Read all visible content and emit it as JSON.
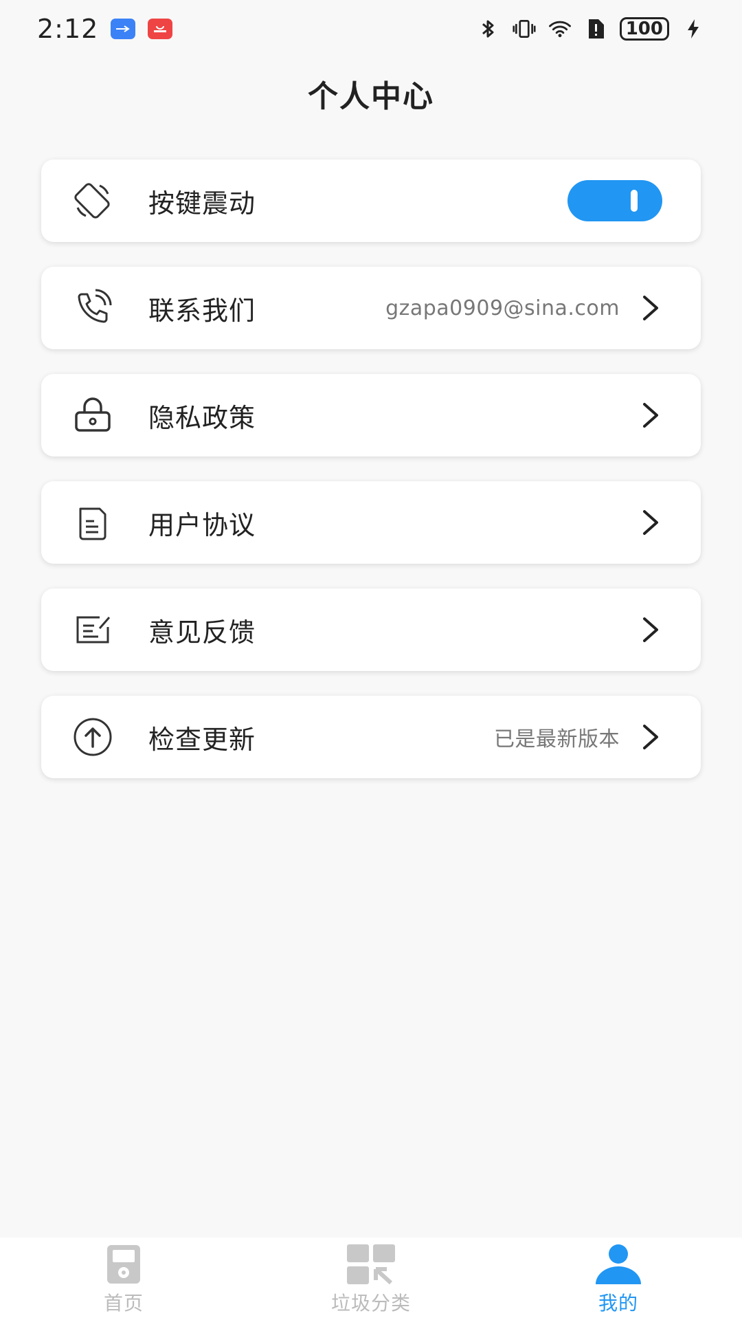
{
  "status_bar": {
    "time": "2:12",
    "battery": "100"
  },
  "header": {
    "title": "个人中心"
  },
  "menu": {
    "vibration": {
      "label": "按键震动",
      "icon": "rotate-phone-icon",
      "toggle_on": true
    },
    "contact": {
      "label": "联系我们",
      "value": "gzapa0909@sina.com",
      "icon": "phone-call-icon"
    },
    "privacy": {
      "label": "隐私政策",
      "icon": "lock-icon"
    },
    "agreement": {
      "label": "用户协议",
      "icon": "document-icon"
    },
    "feedback": {
      "label": "意见反馈",
      "icon": "edit-note-icon"
    },
    "update": {
      "label": "检查更新",
      "value": "已是最新版本",
      "icon": "upload-circle-icon"
    }
  },
  "bottom_nav": {
    "items": [
      {
        "label": "首页",
        "icon": "home-device-icon",
        "active": false
      },
      {
        "label": "垃圾分类",
        "icon": "category-grid-icon",
        "active": false
      },
      {
        "label": "我的",
        "icon": "person-icon",
        "active": true
      }
    ]
  },
  "colors": {
    "accent": "#2196f3",
    "background": "#f8f8f8",
    "card": "#ffffff",
    "inactive_nav": "#bbbbbb"
  }
}
